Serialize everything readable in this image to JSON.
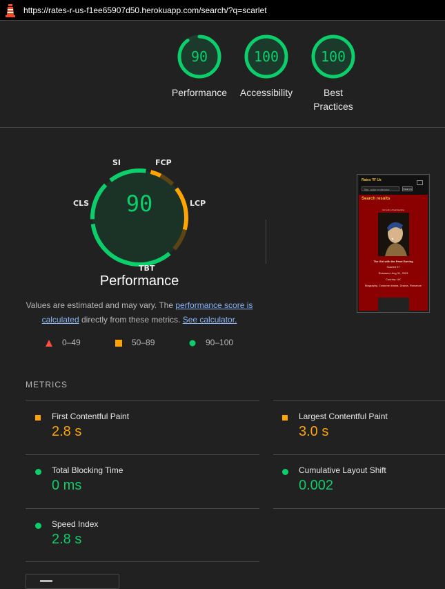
{
  "urlbar": {
    "url": "https://rates-r-us-f1ee65907d50.herokuapp.com/search/?q=scarlet",
    "logo_icon": "lighthouse-icon"
  },
  "summary": [
    {
      "score": "90",
      "label": "Performance",
      "fraction": 0.9
    },
    {
      "score": "100",
      "label": "Accessibility",
      "fraction": 1.0
    },
    {
      "score": "100",
      "label_line1": "Best",
      "label_line2": "Practices",
      "fraction": 1.0
    }
  ],
  "performance": {
    "score": "90",
    "title": "Performance",
    "note_pre": "Values are estimated and may vary. The ",
    "note_link1": "performance score is calculated",
    "note_mid": " directly from these metrics. ",
    "note_link2": "See calculator.",
    "gauge_metrics": [
      "SI",
      "FCP",
      "LCP",
      "TBT",
      "CLS"
    ]
  },
  "legend": [
    {
      "icon": "triangle-fail-icon",
      "label": "0–49",
      "color": "#ff4e42"
    },
    {
      "icon": "square-average-icon",
      "label": "50–89",
      "color": "#ffa400"
    },
    {
      "icon": "circle-pass-icon",
      "label": "90–100",
      "color": "#0cce6b"
    }
  ],
  "screenshot": {
    "brand": "Rates 'R' Us",
    "search_placeholder": "Title, actor or director",
    "search_button": "Search",
    "heading": "Search results",
    "caption": "Girl with a Pearl Earring",
    "movie_title": "The Girl with the Pearl Earring",
    "rating_line": "Scarlett 97",
    "released": "Released: Aug 31, 2003",
    "country": "Country: UK",
    "genres": "Biography, Costume drama, Drama, Romance"
  },
  "metrics": {
    "heading": "METRICS",
    "items": [
      {
        "name": "First Contentful Paint",
        "value": "2.8 s",
        "status": "average"
      },
      {
        "name": "Largest Contentful Paint",
        "value": "3.0 s",
        "status": "average"
      },
      {
        "name": "Total Blocking Time",
        "value": "0 ms",
        "status": "pass"
      },
      {
        "name": "Cumulative Layout Shift",
        "value": "0.002",
        "status": "pass"
      },
      {
        "name": "Speed Index",
        "value": "2.8 s",
        "status": "pass"
      }
    ]
  },
  "colors": {
    "pass": "#0cce6b",
    "average": "#ffa400",
    "fail": "#ff4e42",
    "background": "#212121"
  }
}
